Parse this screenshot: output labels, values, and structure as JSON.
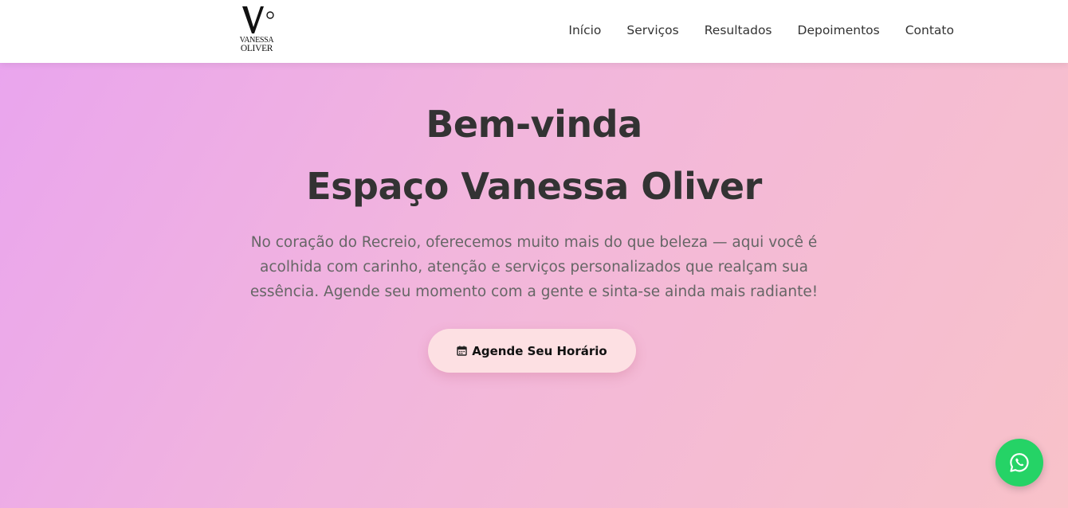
{
  "logo": {
    "line1": "VANESSA",
    "line2": "OLIVER"
  },
  "nav": {
    "items": [
      {
        "label": "Início"
      },
      {
        "label": "Serviços"
      },
      {
        "label": "Resultados"
      },
      {
        "label": "Depoimentos"
      },
      {
        "label": "Contato"
      }
    ]
  },
  "hero": {
    "title_line1": "Bem-vinda",
    "title_line2": "Espaço Vanessa Oliver",
    "description": "No coração do Recreio, oferecemos muito mais do que beleza — aqui você é acolhida com carinho, atenção e serviços personalizados que realçam sua essência. Agende seu momento com a gente e sinta-se ainda mais radiante!",
    "cta_label": "Agende Seu Horário",
    "cta_icon": "calendar-icon"
  },
  "floating": {
    "whatsapp_icon": "whatsapp-icon"
  },
  "colors": {
    "gradient_start": "#e9a4ef",
    "gradient_end": "#f8c2c9",
    "text_dark": "#333333",
    "cta_bg": "#fde0e3",
    "whatsapp": "#25d366"
  }
}
